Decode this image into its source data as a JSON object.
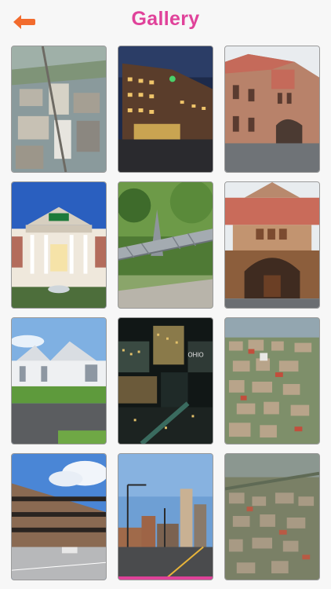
{
  "header": {
    "title": "Gallery",
    "back_icon": "back-arrow-icon",
    "accent_color": "#e0429a",
    "back_color": "#f26b2d"
  },
  "gallery": {
    "photos": [
      {
        "subject": "aerial-city-view"
      },
      {
        "subject": "hotel-night"
      },
      {
        "subject": "brick-station-building"
      },
      {
        "subject": "holiday-inn-express"
      },
      {
        "subject": "iron-bridge"
      },
      {
        "subject": "station-arch-entrance"
      },
      {
        "subject": "white-house-lawn"
      },
      {
        "subject": "city-night-aerial"
      },
      {
        "subject": "town-aerial"
      },
      {
        "subject": "parking-garage"
      },
      {
        "subject": "downtown-street"
      },
      {
        "subject": "aerial-town-overview"
      }
    ]
  }
}
